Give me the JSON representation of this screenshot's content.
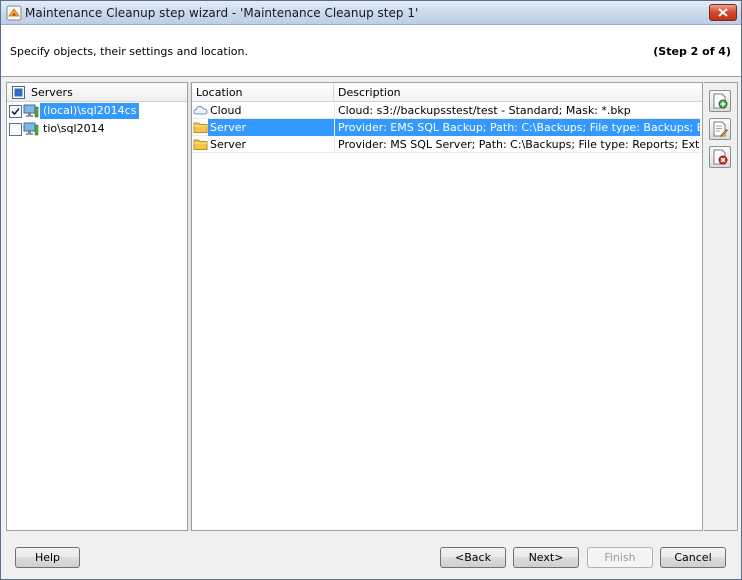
{
  "window": {
    "title": "Maintenance Cleanup step wizard - 'Maintenance Cleanup step 1'"
  },
  "header": {
    "description": "Specify objects, their settings and location.",
    "step": "(Step 2 of 4)"
  },
  "servers": {
    "header_label": "Servers",
    "items": [
      {
        "name": "(local)\\sql2014cs",
        "checked": true,
        "selected": true
      },
      {
        "name": "tio\\sql2014",
        "checked": false,
        "selected": false
      }
    ]
  },
  "locations": {
    "columns": [
      "Location",
      "Description"
    ],
    "rows": [
      {
        "icon": "cloud-icon",
        "location": "Cloud",
        "description": "Cloud: s3://backupsstest/test - Standard; Mask: *.bkp",
        "selected": false
      },
      {
        "icon": "folder-icon",
        "location": "Server",
        "description": "Provider: EMS SQL Backup; Path: C:\\Backups; File type: Backups; Extension: bkp",
        "selected": true
      },
      {
        "icon": "folder-icon",
        "location": "Server",
        "description": "Provider: MS SQL Server; Path: C:\\Backups; File type: Reports; Extension: txt",
        "selected": false
      }
    ]
  },
  "toolbar": {
    "icons": [
      "add-location-icon",
      "edit-location-icon",
      "delete-location-icon"
    ]
  },
  "buttons": {
    "help": "Help",
    "back": "<Back",
    "next": "Next>",
    "finish": "Finish",
    "cancel": "Cancel"
  },
  "colors": {
    "selection": "#3399ff",
    "titlebar": "#c9d8ec",
    "close_button": "#d2472a"
  }
}
